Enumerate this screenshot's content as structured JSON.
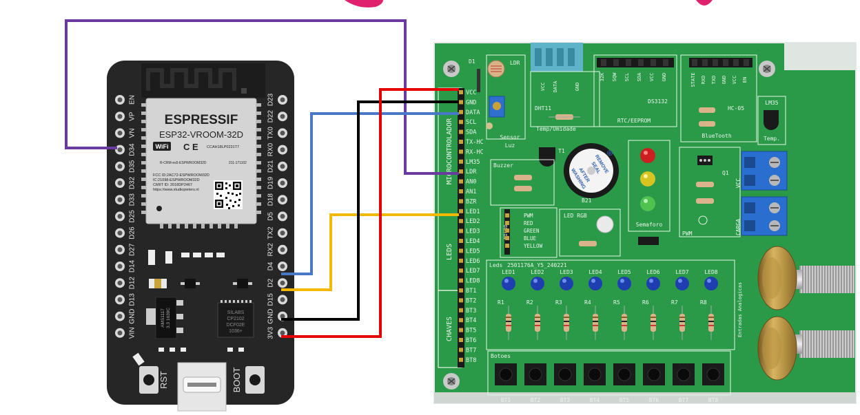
{
  "esp32": {
    "brand": "ESPRESSIF",
    "module": "ESP32-VROOM-32D",
    "wifi": "WiFi",
    "ce": "C E",
    "ccah": "CCAH18LP0231T7",
    "cmiit": "R-CRM-es5-ESPWROOM32D",
    "id211": "211-171102",
    "fcc": "FCC ID:2AC72-ESPWROOM32D",
    "ic": "IC:21098-ESPWROOM32D",
    "cmiit_id": "CMIIT ID: 2018DP2467",
    "url": "https://www.studiopieters.nl",
    "left_pins": [
      "EN",
      "VP",
      "VN",
      "D34",
      "D35",
      "D32",
      "D33",
      "D25",
      "D26",
      "D27",
      "D14",
      "D12",
      "D13",
      "GND",
      "VIN"
    ],
    "right_pins": [
      "D23",
      "D22",
      "TX0",
      "RX0",
      "D21",
      "D19",
      "D18",
      "D5",
      "TX2",
      "RX2",
      "D4",
      "D2",
      "D15",
      "GND",
      "3V3"
    ],
    "reg_chip": "AMS1117\n3.3 1639C",
    "usb_chip": [
      "SILABS",
      "CP2102",
      "DCF02E",
      "1036+"
    ],
    "rst": "RST",
    "boot": "BOOT"
  },
  "board": {
    "left_pins": [
      "VCC",
      "GND",
      "DATA",
      "SCL",
      "SDA",
      "TX-HC",
      "RX-HC",
      "LM35",
      "LDR",
      "AN0",
      "AN1",
      "BZR",
      "LED1",
      "LED2",
      "LED3",
      "LED4",
      "LED5",
      "LED6",
      "LED7",
      "LED8",
      "BT1",
      "BT2",
      "BT3",
      "BT4",
      "BT5",
      "BT6",
      "BT7",
      "BT8"
    ],
    "group_labels": [
      "MICROCONTROLADOR",
      "LEDS",
      "CHAVES"
    ],
    "ldr_label": "LDR",
    "d1": "D1",
    "sensor_luz": "Sensor\nLuz",
    "dht_pins": [
      "VCC",
      "DATA",
      "GND"
    ],
    "dht": "DHT11",
    "temp_umidade": "Temp/Umidade",
    "rtc_pins": [
      "32K",
      "SQW",
      "SCL",
      "SDA",
      "VCC",
      "GND"
    ],
    "ds": "DS3132",
    "rtc": "RTC/EEPROM",
    "hc_pins": [
      "STATE",
      "RXD",
      "TXD",
      "GND",
      "VCC",
      "EN"
    ],
    "hc05": "HC-05",
    "bluetooth": "BlueTooth",
    "lm35": "LM35",
    "temp": "Temp.",
    "t1": "T1",
    "buzzer": "Buzzer",
    "buzzer_sticker": [
      "REMOVE",
      "SEAL",
      "AFTER",
      "WASHING"
    ],
    "b21": "B21",
    "semaforo": "Semaforo",
    "q1": "Q1",
    "vcc": "VCC",
    "carga": "CARGA",
    "pwm_label": "PWM",
    "micro_pins": [
      "PWM",
      "RED",
      "GREEN",
      "BLUE",
      "YELLOW"
    ],
    "micro": "MICRO",
    "led_rgb": "LED RGB",
    "leds_title": "Leds",
    "leds_code": "2501176A_Y5_240221",
    "leds": [
      "LED1",
      "LED2",
      "LED3",
      "LED4",
      "LED5",
      "LED6",
      "LED7",
      "LED8"
    ],
    "resistors": [
      "R1",
      "R2",
      "R3",
      "R4",
      "R5",
      "R6",
      "R7",
      "R8"
    ],
    "entradas": "Entradas Analogicas",
    "botoes": "Botoes",
    "buttons": [
      "BT1",
      "BT2",
      "BT3",
      "BT4",
      "BT5",
      "BT6",
      "BT7",
      "BT8"
    ]
  },
  "colors": {
    "wire_purple": "#6a3aa0",
    "wire_blue": "#4a78c8",
    "wire_yellow": "#f3b800",
    "wire_black": "#000000",
    "wire_red": "#e50000",
    "pcb": "#1f8a3c",
    "esp_board": "#262626",
    "title_pink": "#e0226e"
  }
}
